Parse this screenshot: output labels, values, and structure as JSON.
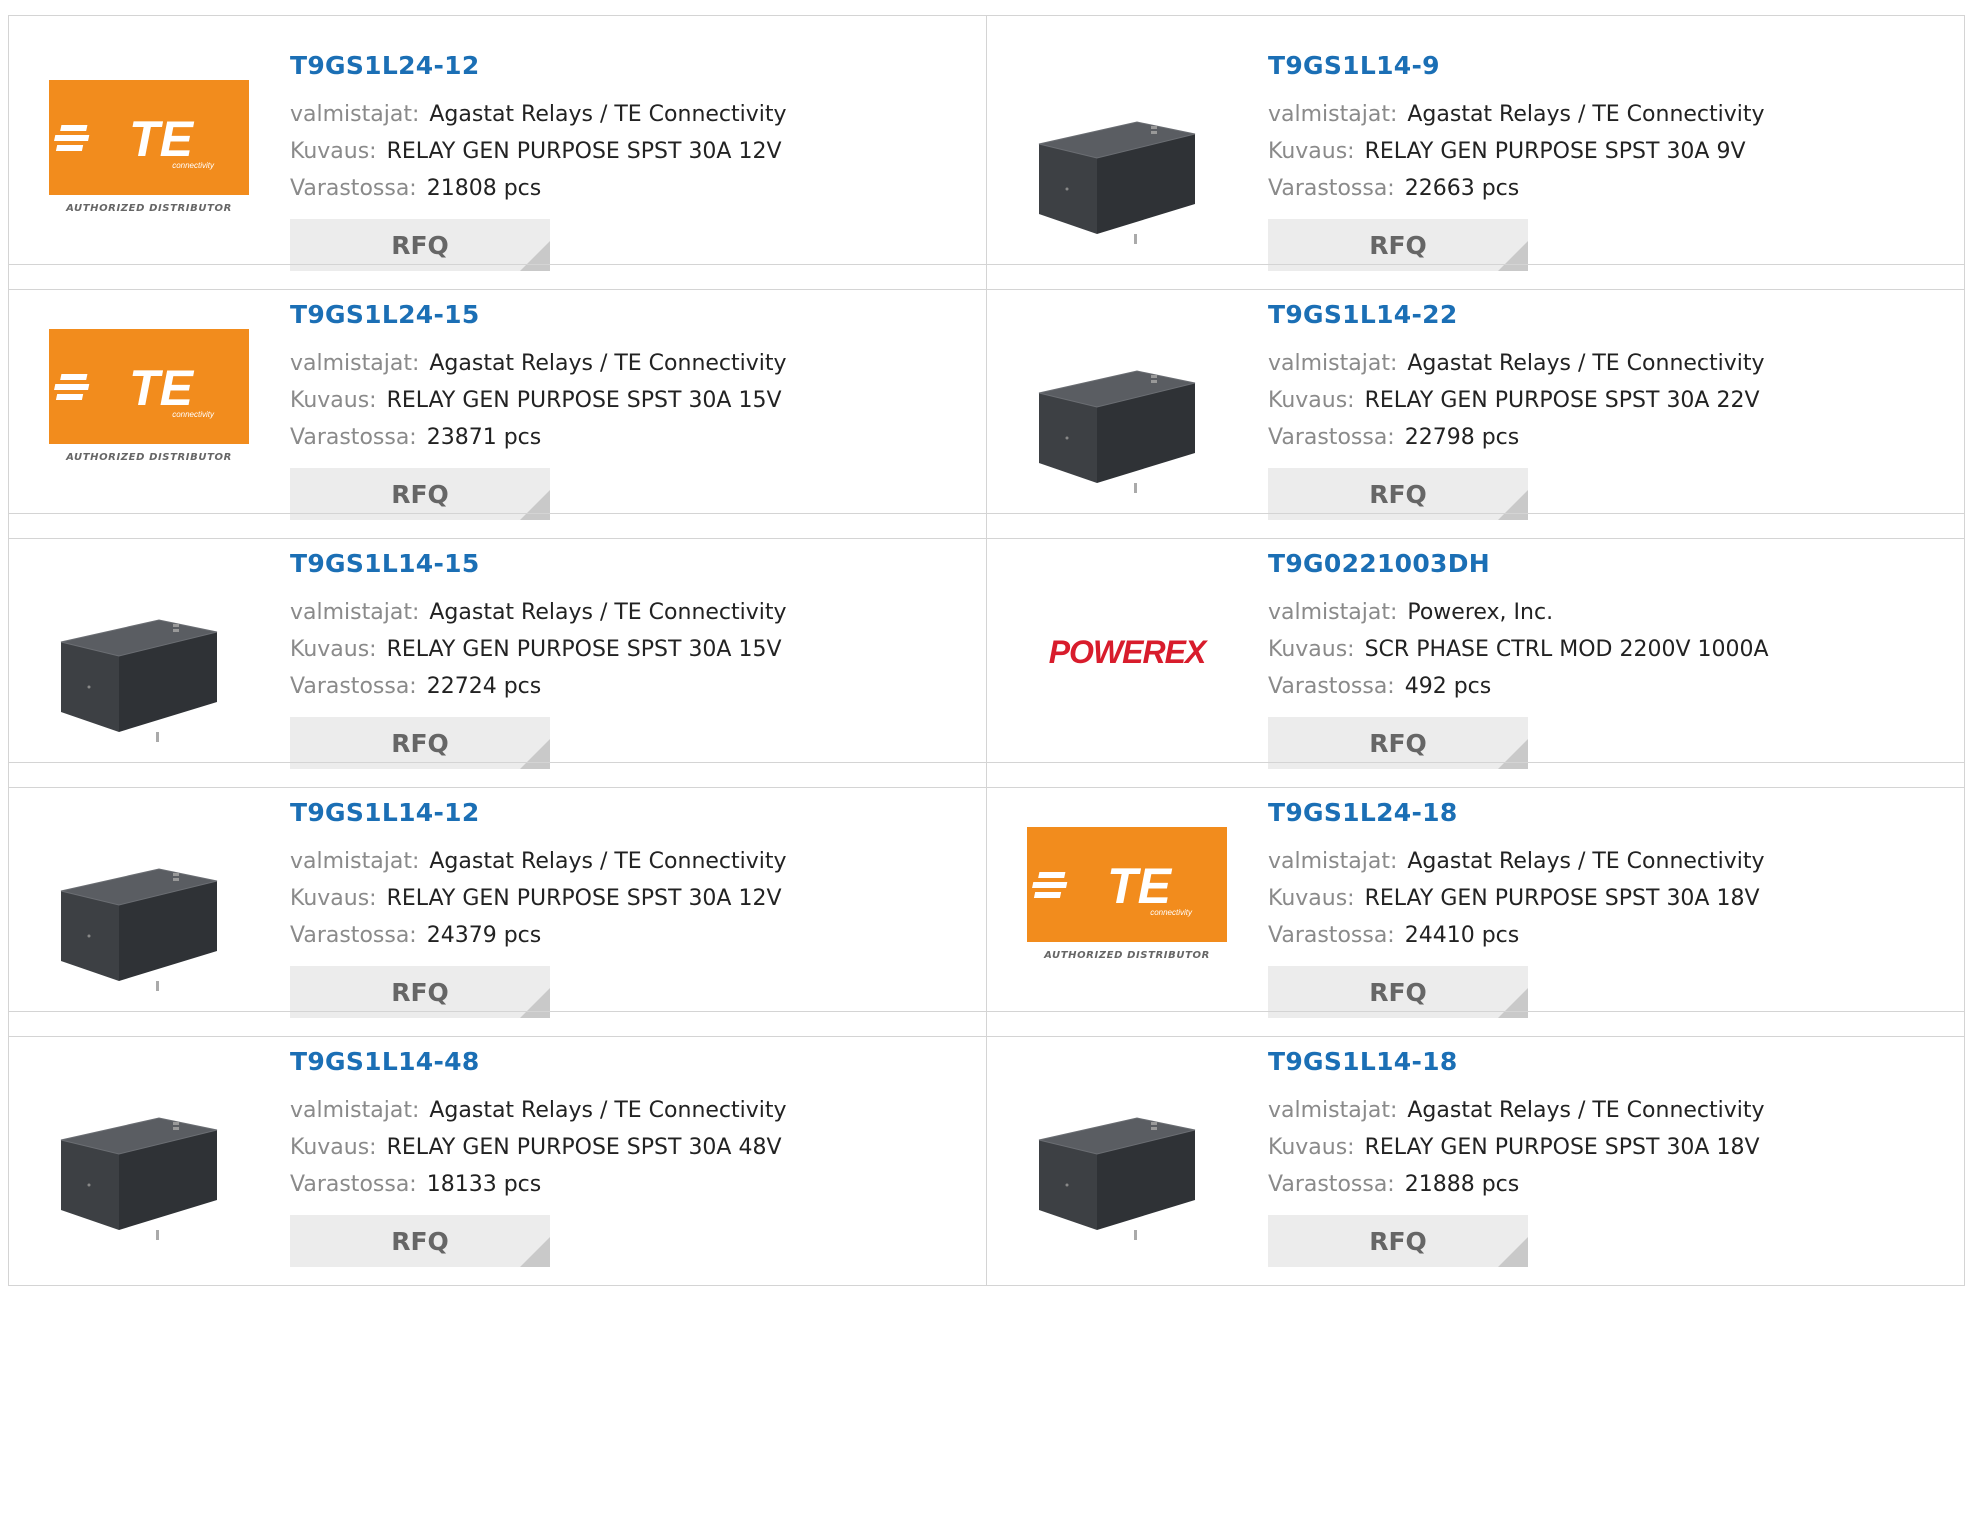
{
  "labels": {
    "manufacturer": "valmistajat:",
    "description": "Kuvaus:",
    "stock": "Varastossa:",
    "rfq": "RFQ"
  },
  "te_logo": {
    "wordmark": "TE",
    "tagline": "connectivity",
    "distributor": "AUTHORIZED DISTRIBUTOR"
  },
  "powerex_logo": {
    "wordmark": "POWEREX"
  },
  "products": [
    {
      "part": "T9GS1L24-12",
      "manufacturer": "Agastat Relays / TE Connectivity",
      "description": "RELAY GEN PURPOSE SPST 30A 12V",
      "stock": "21808 pcs",
      "image": "te-logo"
    },
    {
      "part": "T9GS1L14-9",
      "manufacturer": "Agastat Relays / TE Connectivity",
      "description": "RELAY GEN PURPOSE SPST 30A 9V",
      "stock": "22663 pcs",
      "image": "relay-photo"
    },
    {
      "part": "T9GS1L24-15",
      "manufacturer": "Agastat Relays / TE Connectivity",
      "description": "RELAY GEN PURPOSE SPST 30A 15V",
      "stock": "23871 pcs",
      "image": "te-logo"
    },
    {
      "part": "T9GS1L14-22",
      "manufacturer": "Agastat Relays / TE Connectivity",
      "description": "RELAY GEN PURPOSE SPST 30A 22V",
      "stock": "22798 pcs",
      "image": "relay-photo"
    },
    {
      "part": "T9GS1L14-15",
      "manufacturer": "Agastat Relays / TE Connectivity",
      "description": "RELAY GEN PURPOSE SPST 30A 15V",
      "stock": "22724 pcs",
      "image": "relay-photo"
    },
    {
      "part": "T9G0221003DH",
      "manufacturer": "Powerex, Inc.",
      "description": "SCR PHASE CTRL MOD 2200V 1000A",
      "stock": "492 pcs",
      "image": "powerex-logo"
    },
    {
      "part": "T9GS1L14-12",
      "manufacturer": "Agastat Relays / TE Connectivity",
      "description": "RELAY GEN PURPOSE SPST 30A 12V",
      "stock": "24379 pcs",
      "image": "relay-photo"
    },
    {
      "part": "T9GS1L24-18",
      "manufacturer": "Agastat Relays / TE Connectivity",
      "description": "RELAY GEN PURPOSE SPST 30A 18V",
      "stock": "24410 pcs",
      "image": "te-logo"
    },
    {
      "part": "T9GS1L14-48",
      "manufacturer": "Agastat Relays / TE Connectivity",
      "description": "RELAY GEN PURPOSE SPST 30A 48V",
      "stock": "18133 pcs",
      "image": "relay-photo"
    },
    {
      "part": "T9GS1L14-18",
      "manufacturer": "Agastat Relays / TE Connectivity",
      "description": "RELAY GEN PURPOSE SPST 30A 18V",
      "stock": "21888 pcs",
      "image": "relay-photo"
    }
  ]
}
